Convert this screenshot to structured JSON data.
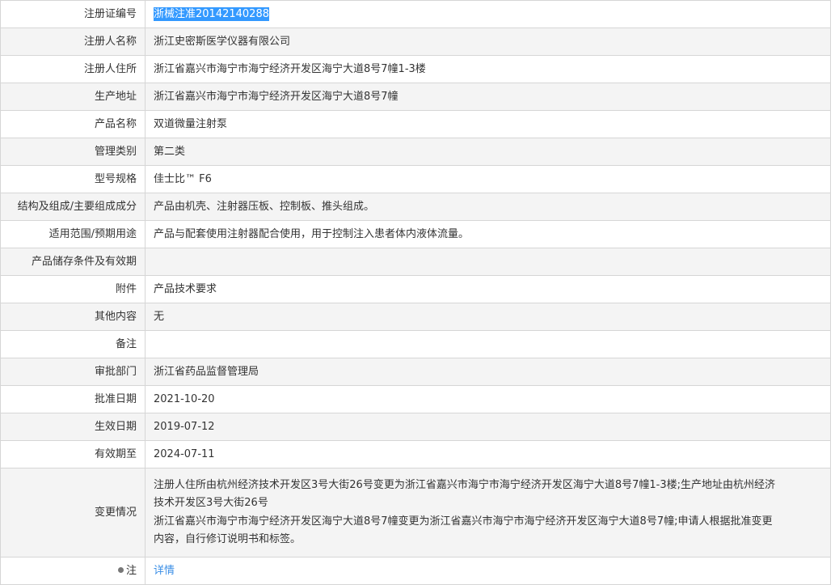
{
  "rows": [
    {
      "label": "注册证编号",
      "value": "浙械注准20142140288"
    },
    {
      "label": "注册人名称",
      "value": "浙江史密斯医学仪器有限公司"
    },
    {
      "label": "注册人住所",
      "value": "浙江省嘉兴市海宁市海宁经济开发区海宁大道8号7幢1-3楼"
    },
    {
      "label": "生产地址",
      "value": "浙江省嘉兴市海宁市海宁经济开发区海宁大道8号7幢"
    },
    {
      "label": "产品名称",
      "value": "双道微量注射泵"
    },
    {
      "label": "管理类别",
      "value": "第二类"
    },
    {
      "label": "型号规格",
      "value": "佳士比™ F6"
    },
    {
      "label": "结构及组成/主要组成成分",
      "value": "产品由机壳、注射器压板、控制板、推头组成。"
    },
    {
      "label": "适用范围/预期用途",
      "value": "产品与配套使用注射器配合使用，用于控制注入患者体内液体流量。"
    },
    {
      "label": "产品储存条件及有效期",
      "value": ""
    },
    {
      "label": "附件",
      "value": "产品技术要求"
    },
    {
      "label": "其他内容",
      "value": "无"
    },
    {
      "label": "备注",
      "value": ""
    },
    {
      "label": "审批部门",
      "value": "浙江省药品监督管理局"
    },
    {
      "label": "批准日期",
      "value": "2021-10-20"
    },
    {
      "label": "生效日期",
      "value": "2019-07-12"
    },
    {
      "label": "有效期至",
      "value": "2024-07-11"
    },
    {
      "label": "变更情况",
      "value": "注册人住所由杭州经济技术开发区3号大街26号变更为浙江省嘉兴市海宁市海宁经济开发区海宁大道8号7幢1-3楼;生产地址由杭州经济技术开发区3号大街26号浙江省嘉兴市海宁市海宁经济开发区海宁大道8号7幢变更为浙江省嘉兴市海宁市海宁经济开发区海宁大道8号7幢;申请人根据批准变更内容，自行修订说明书和标签。"
    },
    {
      "label": "注",
      "value": "详情"
    }
  ],
  "change_lines": [
    "注册人住所由杭州经济技术开发区3号大街26号变更为浙江省嘉兴市海宁市海宁经济开发区海宁大道8号7幢1-3楼;生产地址由杭州经济",
    "技术开发区3号大街26号",
    "浙江省嘉兴市海宁市海宁经济开发区海宁大道8号7幢变更为浙江省嘉兴市海宁市海宁经济开发区海宁大道8号7幢;申请人根据批准变更",
    "内容，自行修订说明书和标签。"
  ]
}
